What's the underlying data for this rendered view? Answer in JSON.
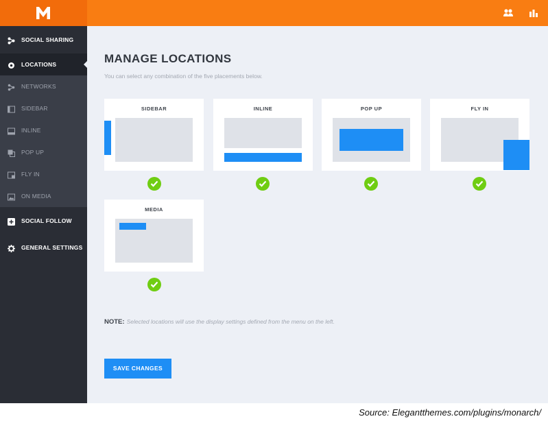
{
  "app": {
    "logo_letter": "M",
    "accent": "#f97d12",
    "primary_blue": "#1e8ef5",
    "check_green": "#6fcd12"
  },
  "topbar": {
    "icons": [
      "users-icon",
      "stats-icon"
    ]
  },
  "sidebar": {
    "items": [
      {
        "label": "SOCIAL SHARING",
        "icon": "share-icon",
        "type": "section"
      },
      {
        "label": "LOCATIONS",
        "icon": "location-pin-icon",
        "type": "active"
      },
      {
        "label": "NETWORKS",
        "icon": "network-icon",
        "type": "sub"
      },
      {
        "label": "SIDEBAR",
        "icon": "sidebar-icon",
        "type": "sub"
      },
      {
        "label": "INLINE",
        "icon": "inline-icon",
        "type": "sub"
      },
      {
        "label": "POP UP",
        "icon": "popup-icon",
        "type": "sub"
      },
      {
        "label": "FLY IN",
        "icon": "flyin-icon",
        "type": "sub"
      },
      {
        "label": "ON MEDIA",
        "icon": "media-icon",
        "type": "sub"
      },
      {
        "label": "SOCIAL FOLLOW",
        "icon": "plus-icon",
        "type": "section"
      },
      {
        "label": "GENERAL SETTINGS",
        "icon": "gear-icon",
        "type": "section"
      }
    ]
  },
  "main": {
    "title": "MANAGE LOCATIONS",
    "subtitle": "You can select any combination of the five placements below.",
    "cards": [
      {
        "label": "SIDEBAR",
        "selected": true
      },
      {
        "label": "INLINE",
        "selected": true
      },
      {
        "label": "POP UP",
        "selected": true
      },
      {
        "label": "FLY IN",
        "selected": true
      },
      {
        "label": "MEDIA",
        "selected": true
      }
    ],
    "note_label": "NOTE:",
    "note_text": "Selected locations will use the display settings defined from the menu on the left.",
    "save_label": "SAVE CHANGES"
  },
  "source": "Source: Elegantthemes.com/plugins/monarch/"
}
